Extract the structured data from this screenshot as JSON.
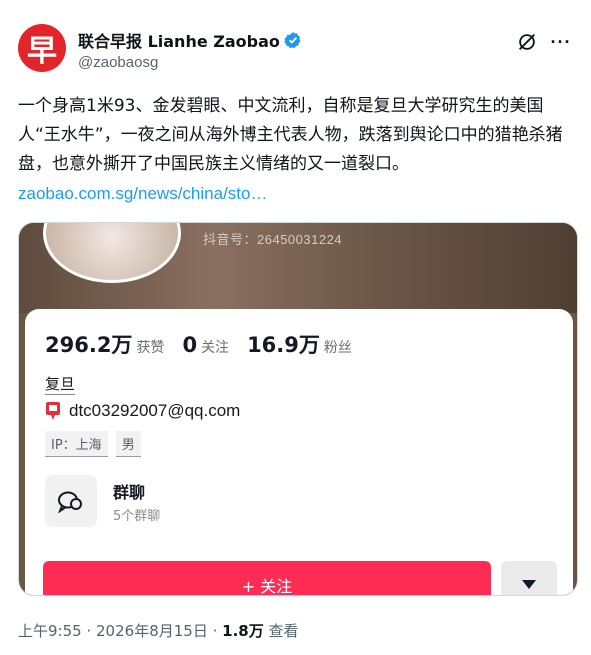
{
  "author": {
    "avatar_glyph": "早",
    "display_name": "联合早报 Lianhe Zaobao",
    "handle": "@zaobaosg",
    "verified_color": "#1d9bf0",
    "brand_color": "#e3242b"
  },
  "header": {
    "grok_icon": "slash-circle-icon",
    "more_label": "···"
  },
  "post": {
    "text": "一个身高1米93、金发碧眼、中文流利，自称是复旦大学研究生的美国人“王水牛”，一夜之间从海外博主代表人物，跌落到舆论口中的猎艳杀猪盘，也意外撕开了中国民族主义情绪的又一道裂口。",
    "link": "zaobao.com.sg/news/china/sto…",
    "link_color": "#1d9bf0"
  },
  "media": {
    "douyin_id": "抖音号：26450031224",
    "stats": [
      {
        "value": "296.2万",
        "label": "获赞"
      },
      {
        "value": "0",
        "label": "关注"
      },
      {
        "value": "16.9万",
        "label": "粉丝"
      }
    ],
    "school": "复旦",
    "email": "dtc03292007@qq.com",
    "tags": [
      "IP：上海",
      "男"
    ],
    "group_title": "群聊",
    "group_sub": "5个群聊",
    "follow_label": "+ 关注",
    "follow_color": "#fe2c55"
  },
  "meta": {
    "time": "上午9:55",
    "date": "2026年8月15日",
    "views_count": "1.8万",
    "views_label": "查看"
  }
}
